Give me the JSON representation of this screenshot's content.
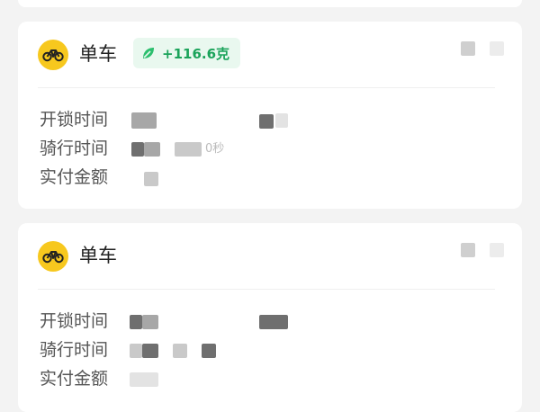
{
  "theme": {
    "accent": "#f7c81e",
    "carbon_green": "#1aa35a"
  },
  "rides": [
    {
      "title": "单车",
      "carbon_saving": "+116.6克",
      "fields": [
        {
          "label": "开锁时间"
        },
        {
          "label": "骑行时间",
          "suffix": "0秒"
        },
        {
          "label": "实付金额"
        }
      ]
    },
    {
      "title": "单车",
      "fields": [
        {
          "label": "开锁时间"
        },
        {
          "label": "骑行时间"
        },
        {
          "label": "实付金额"
        }
      ]
    }
  ]
}
